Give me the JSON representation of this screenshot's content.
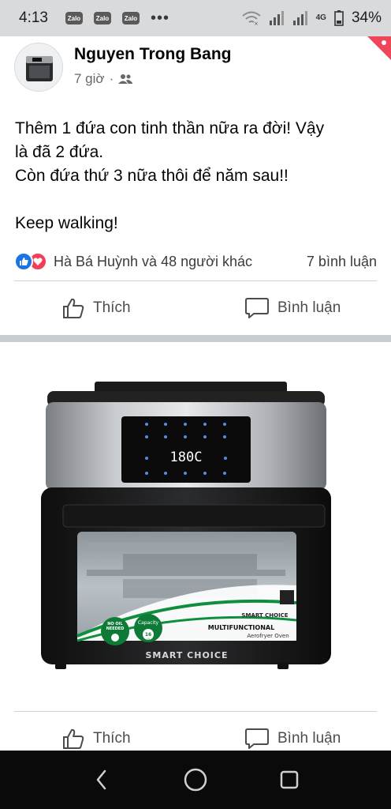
{
  "status_bar": {
    "time": "4:13",
    "notifications": [
      "Zalo",
      "Zalo",
      "Zalo"
    ],
    "more": "•••",
    "network": "4G",
    "battery": "34%"
  },
  "post": {
    "author": "Nguyen Trong Bang",
    "time": "7 giờ",
    "separator": "·",
    "audience_icon": "friends-icon",
    "text_lines": [
      "Thêm 1 đứa con tinh thần nữa ra đời! Vậy\nlà đã 2 đứa.",
      "Còn đứa thứ 3 nữa thôi để năm sau!!",
      "",
      "Keep walking!"
    ],
    "reactions": {
      "types": [
        "like",
        "love"
      ],
      "names": "Hà Bá Huỳnh và 48 người khác",
      "comments": "7 bình luận"
    },
    "actions": {
      "like": "Thích",
      "comment": "Bình luận"
    }
  },
  "product_photo": {
    "display": "180C",
    "brand_panel_label": "SMART CHOICE",
    "brand_footer": "SMART CHOICE",
    "line1": "MULTIFUNCTIONAL",
    "line2": "Aerofryer Oven",
    "badge1_top": "NO OIL",
    "badge1_bottom": "NEEDED",
    "badge2_top": "Capacity",
    "badge2_value": "16",
    "badge2_unit": "Lít"
  },
  "second_post_actions": {
    "like": "Thích",
    "comment": "Bình luận"
  },
  "nav_bar": {
    "buttons": [
      "back-icon",
      "home-icon",
      "recents-icon"
    ]
  },
  "colors": {
    "facebook_blue": "#1b74e4",
    "love_red": "#f33e58",
    "status_bar_bg": "#d9dadc",
    "nav_bar_bg": "#0a0a0a"
  }
}
